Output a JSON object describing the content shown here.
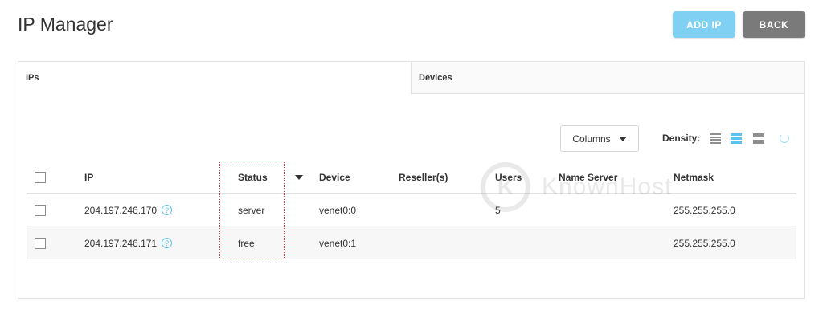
{
  "header": {
    "title": "IP Manager",
    "add_ip_label": "ADD IP",
    "back_label": "BACK"
  },
  "tabs": [
    {
      "label": "IPs",
      "active": true
    },
    {
      "label": "Devices",
      "active": false
    }
  ],
  "toolbar": {
    "columns_label": "Columns",
    "density_label": "Density:"
  },
  "table": {
    "columns": [
      "IP",
      "Status",
      "Device",
      "Reseller(s)",
      "Users",
      "Name Server",
      "Netmask"
    ],
    "rows": [
      {
        "ip": "204.197.246.170",
        "status": "server",
        "device": "venet0:0",
        "resellers": "",
        "users": "5",
        "name_server": "",
        "netmask": "255.255.255.0"
      },
      {
        "ip": "204.197.246.171",
        "status": "free",
        "device": "venet0:1",
        "resellers": "",
        "users": "",
        "name_server": "",
        "netmask": "255.255.255.0"
      }
    ]
  },
  "watermark": {
    "logo_letter": "K",
    "text": "KnownHost"
  },
  "colors": {
    "accent": "#7fd0f3",
    "back_button": "#7a7a7a",
    "highlight_border": "#d9363e"
  },
  "icons": [
    "help-icon",
    "density-compact-icon",
    "density-normal-icon",
    "density-comfortable-icon",
    "refresh-icon",
    "caret-down-icon",
    "sort-caret-icon"
  ]
}
